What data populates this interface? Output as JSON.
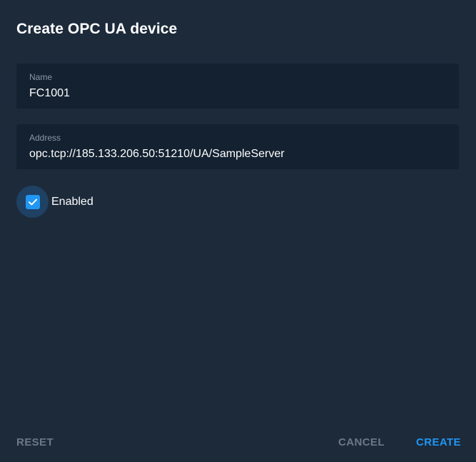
{
  "dialog": {
    "title": "Create OPC UA device",
    "name_field": {
      "label": "Name",
      "value": "FC1001"
    },
    "address_field": {
      "label": "Address",
      "value": "opc.tcp://185.133.206.50:51210/UA/SampleServer"
    },
    "enabled": {
      "label": "Enabled",
      "checked": true
    },
    "actions": {
      "reset_label": "RESET",
      "cancel_label": "CANCEL",
      "create_label": "CREATE"
    }
  },
  "colors": {
    "background": "#1c2a3a",
    "field_background": "#132130",
    "accent": "#2196f3",
    "muted_button": "#6c7885",
    "field_label": "#8b97a4",
    "text": "#ffffff"
  },
  "icons": {
    "checkbox": "check-icon"
  }
}
